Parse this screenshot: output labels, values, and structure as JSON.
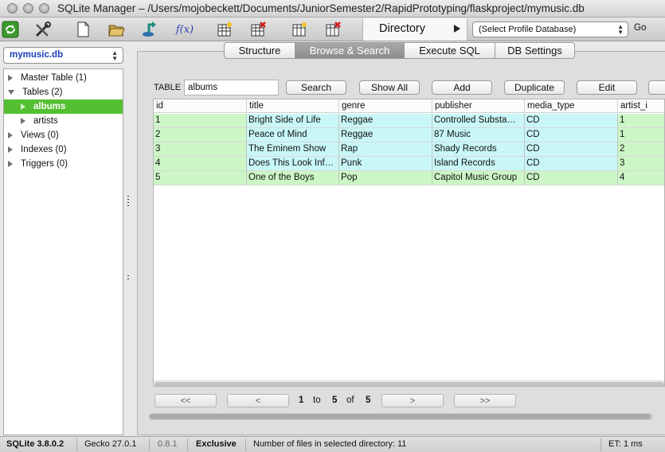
{
  "window": {
    "title": "SQLite Manager – /Users/mojobeckett/Documents/JuniorSemester2/RapidPrototyping/flaskproject/mymusic.db"
  },
  "toolbar": {
    "icons": [
      "refresh-icon",
      "tools-icon",
      "new-db-icon",
      "open-db-icon",
      "export-icon",
      "function-icon",
      "create-table-icon",
      "drop-table-icon",
      "create-index-icon",
      "drop-index-icon"
    ],
    "function_label": "f(x)",
    "directory_label": "Directory",
    "profile_select": "(Select Profile Database)",
    "go_label": "Go"
  },
  "sidebar": {
    "db_select": "mymusic.db",
    "tree": [
      {
        "label": "Master Table (1)",
        "expanded": false,
        "level": 0,
        "selected": false
      },
      {
        "label": "Tables (2)",
        "expanded": true,
        "level": 0,
        "selected": false
      },
      {
        "label": "albums",
        "expanded": false,
        "level": 1,
        "selected": true
      },
      {
        "label": "artists",
        "expanded": false,
        "level": 1,
        "selected": false
      },
      {
        "label": "Views (0)",
        "expanded": false,
        "level": 0,
        "selected": false
      },
      {
        "label": "Indexes (0)",
        "expanded": false,
        "level": 0,
        "selected": false
      },
      {
        "label": "Triggers (0)",
        "expanded": false,
        "level": 0,
        "selected": false
      }
    ]
  },
  "tabs": [
    {
      "label": "Structure",
      "active": false
    },
    {
      "label": "Browse & Search",
      "active": true
    },
    {
      "label": "Execute SQL",
      "active": false
    },
    {
      "label": "DB Settings",
      "active": false
    }
  ],
  "browse": {
    "table_label": "TABLE",
    "table_value": "albums",
    "buttons": [
      "Search",
      "Show All",
      "Add",
      "Duplicate",
      "Edit"
    ],
    "columns": [
      "id",
      "title",
      "genre",
      "publisher",
      "media_type",
      "artist_i"
    ],
    "rows": [
      [
        "1",
        "Bright Side of Life",
        "Reggae",
        "Controlled Substa…",
        "CD",
        "1"
      ],
      [
        "2",
        "Peace of Mind",
        "Reggae",
        "87 Music",
        "CD",
        "1"
      ],
      [
        "3",
        "The Eminem Show",
        "Rap",
        "Shady Records",
        "CD",
        "2"
      ],
      [
        "4",
        "Does This Look Inf…",
        "Punk",
        "Island Records",
        "CD",
        "3"
      ],
      [
        "5",
        "One of the Boys",
        "Pop",
        "Capitol Music Group",
        "CD",
        "4"
      ]
    ],
    "colors": {
      "cyan": "#c9f7f7",
      "green": "#ccf6c6"
    }
  },
  "pager": {
    "first": "<<",
    "prev": "<",
    "next": ">",
    "last": ">>",
    "from": "1",
    "to_label": "to",
    "to": "5",
    "of_label": "of",
    "total": "5"
  },
  "status": {
    "sqlite_version": "SQLite 3.8.0.2",
    "gecko_version": "Gecko 27.0.1",
    "ext_version": "0.8.1",
    "lock_mode": "Exclusive",
    "directory_info": "Number of files in selected directory: 11",
    "elapsed": "ET: 1 ms"
  },
  "theme": {
    "selection": "#55bf32",
    "active_tab": "#9a9a9a",
    "db_name_color": "#1a3fb8"
  }
}
